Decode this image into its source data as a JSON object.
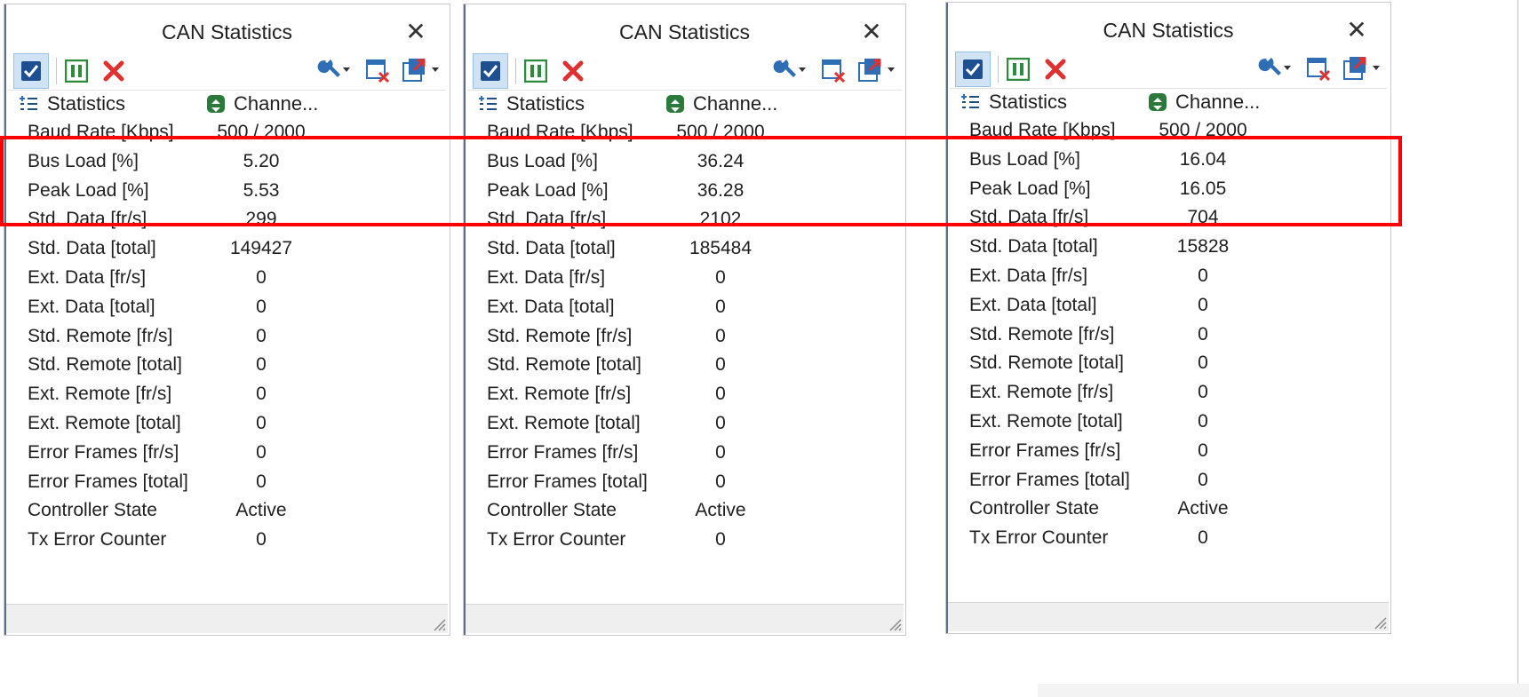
{
  "panels": [
    {
      "title": "CAN Statistics",
      "col_statistics": "Statistics",
      "col_channel": "Channe...",
      "rows": [
        {
          "label": "Baud Rate [Kbps]",
          "value": "500 / 2000"
        },
        {
          "label": "Bus Load [%]",
          "value": "5.20"
        },
        {
          "label": "Peak Load [%]",
          "value": "5.53"
        },
        {
          "label": "Std. Data [fr/s]",
          "value": "299"
        },
        {
          "label": "Std. Data [total]",
          "value": "149427"
        },
        {
          "label": "Ext. Data [fr/s]",
          "value": "0"
        },
        {
          "label": "Ext. Data [total]",
          "value": "0"
        },
        {
          "label": "Std. Remote [fr/s]",
          "value": "0"
        },
        {
          "label": "Std. Remote [total]",
          "value": "0"
        },
        {
          "label": "Ext. Remote [fr/s]",
          "value": "0"
        },
        {
          "label": "Ext. Remote [total]",
          "value": "0"
        },
        {
          "label": "Error Frames [fr/s]",
          "value": "0"
        },
        {
          "label": "Error Frames [total]",
          "value": "0"
        },
        {
          "label": "Controller State",
          "value": "Active"
        },
        {
          "label": "Tx Error Counter",
          "value": "0"
        }
      ]
    },
    {
      "title": "CAN Statistics",
      "col_statistics": "Statistics",
      "col_channel": "Channe...",
      "rows": [
        {
          "label": "Baud Rate [Kbps]",
          "value": "500 / 2000"
        },
        {
          "label": "Bus Load [%]",
          "value": "36.24"
        },
        {
          "label": "Peak Load [%]",
          "value": "36.28"
        },
        {
          "label": "Std. Data [fr/s]",
          "value": "2102"
        },
        {
          "label": "Std. Data [total]",
          "value": "185484"
        },
        {
          "label": "Ext. Data [fr/s]",
          "value": "0"
        },
        {
          "label": "Ext. Data [total]",
          "value": "0"
        },
        {
          "label": "Std. Remote [fr/s]",
          "value": "0"
        },
        {
          "label": "Std. Remote [total]",
          "value": "0"
        },
        {
          "label": "Ext. Remote [fr/s]",
          "value": "0"
        },
        {
          "label": "Ext. Remote [total]",
          "value": "0"
        },
        {
          "label": "Error Frames [fr/s]",
          "value": "0"
        },
        {
          "label": "Error Frames [total]",
          "value": "0"
        },
        {
          "label": "Controller State",
          "value": "Active"
        },
        {
          "label": "Tx Error Counter",
          "value": "0"
        }
      ]
    },
    {
      "title": "CAN Statistics",
      "col_statistics": "Statistics",
      "col_channel": "Channe...",
      "rows": [
        {
          "label": "Baud Rate [Kbps]",
          "value": "500 / 2000"
        },
        {
          "label": "Bus Load [%]",
          "value": "16.04"
        },
        {
          "label": "Peak Load [%]",
          "value": "16.05"
        },
        {
          "label": "Std. Data [fr/s]",
          "value": "704"
        },
        {
          "label": "Std. Data [total]",
          "value": "15828"
        },
        {
          "label": "Ext. Data [fr/s]",
          "value": "0"
        },
        {
          "label": "Ext. Data [total]",
          "value": "0"
        },
        {
          "label": "Std. Remote [fr/s]",
          "value": "0"
        },
        {
          "label": "Std. Remote [total]",
          "value": "0"
        },
        {
          "label": "Ext. Remote [fr/s]",
          "value": "0"
        },
        {
          "label": "Ext. Remote [total]",
          "value": "0"
        },
        {
          "label": "Error Frames [fr/s]",
          "value": "0"
        },
        {
          "label": "Error Frames [total]",
          "value": "0"
        },
        {
          "label": "Controller State",
          "value": "Active"
        },
        {
          "label": "Tx Error Counter",
          "value": "0"
        }
      ]
    }
  ],
  "icons": {
    "close": "close-icon",
    "enable": "checkbox-icon",
    "pause": "pause-icon",
    "stop": "stop-icon",
    "settings": "wrench-icon",
    "delete_window": "delete-window-icon",
    "export": "export-icon",
    "statistics": "list-icon",
    "channel": "channel-sort-icon"
  },
  "colors": {
    "highlight": "#ff0000",
    "check_bg": "#1e4f91",
    "pause": "#2e8b3e",
    "stop": "#e03131",
    "channel_icon": "#2b7a3b"
  }
}
